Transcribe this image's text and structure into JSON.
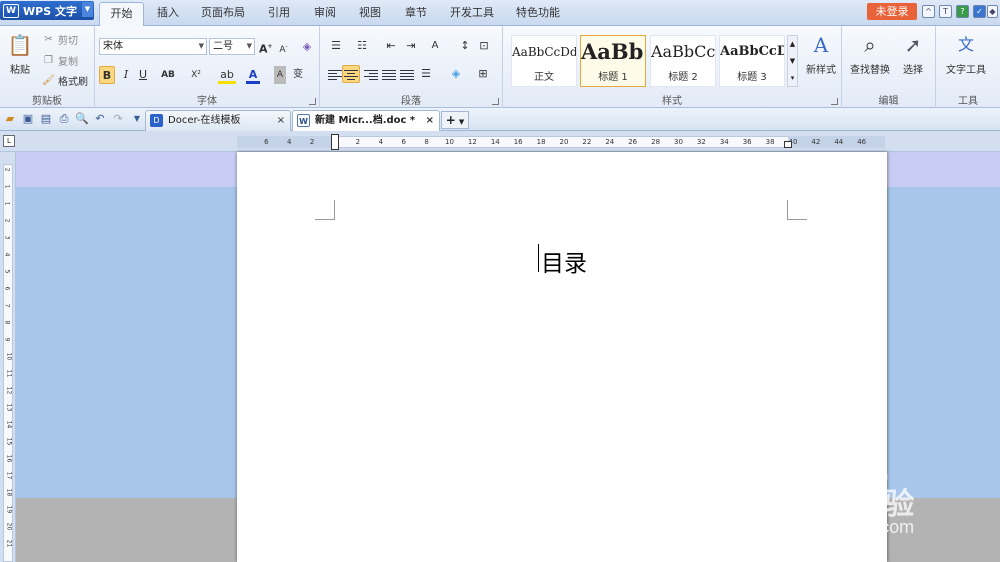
{
  "app": {
    "name": "WPS 文字",
    "login": "未登录"
  },
  "ribbon_tabs": [
    "开始",
    "插入",
    "页面布局",
    "引用",
    "审阅",
    "视图",
    "章节",
    "开发工具",
    "特色功能"
  ],
  "clipboard": {
    "paste": "粘贴",
    "cut": "剪切",
    "copy": "复制",
    "format_painter": "格式刷",
    "label": "剪贴板"
  },
  "font": {
    "family": "宋体",
    "size": "二号",
    "label": "字体",
    "bold": "B",
    "italic": "I",
    "underline": "U",
    "strike": "AB",
    "superscript": "X²"
  },
  "paragraph": {
    "label": "段落"
  },
  "styles": {
    "items": [
      {
        "preview": "AaBbCcDd",
        "name": "正文"
      },
      {
        "preview": "AaBb(",
        "name": "标题 1"
      },
      {
        "preview": "AaBbCc",
        "name": "标题 2"
      },
      {
        "preview": "AaBbCcDd",
        "name": "标题 3"
      }
    ],
    "new_style": "新样式",
    "label": "样式"
  },
  "editing": {
    "find_replace": "查找替换",
    "select": "选择",
    "label": "编辑"
  },
  "tools": {
    "text_tools": "文字工具",
    "label": "工具"
  },
  "doc_tabs": [
    {
      "title": "Docer-在线模板",
      "close": "×"
    },
    {
      "title": "新建 Micr...档.doc *",
      "close": "×"
    }
  ],
  "new_tab": "+",
  "ruler_h": [
    "6",
    "4",
    "2",
    "2",
    "4",
    "6",
    "8",
    "10",
    "12",
    "14",
    "16",
    "18",
    "20",
    "22",
    "24",
    "26",
    "28",
    "30",
    "32",
    "34",
    "36",
    "38",
    "40",
    "42",
    "44",
    "46"
  ],
  "ruler_v": [
    "2",
    "1",
    "1",
    "2",
    "3",
    "4",
    "5",
    "6",
    "7",
    "8",
    "9",
    "10",
    "11",
    "12",
    "13",
    "14",
    "15",
    "16",
    "17",
    "18",
    "19",
    "20",
    "21"
  ],
  "document": {
    "heading": "目录"
  },
  "watermark": {
    "brand": "Baidu经验",
    "url": "jingyan.baidu.com"
  },
  "colors": {
    "accent": "#1a4fa6",
    "login": "#e8623a",
    "highlight": "#fbd77e",
    "workspace": "#a8c6ea"
  }
}
